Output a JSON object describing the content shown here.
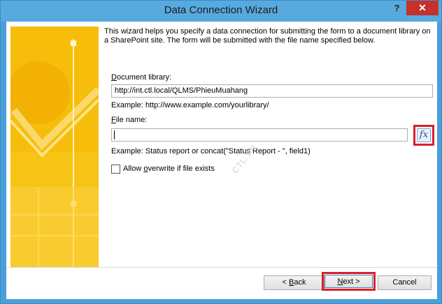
{
  "window": {
    "title": "Data Connection Wizard",
    "help_label": "?",
    "close_label": "✕"
  },
  "intro": {
    "text": "This wizard helps you specify a data connection for submitting the form to a document library on a SharePoint site. The form will be submitted with the file name specified below."
  },
  "document_library": {
    "label_accel": "D",
    "label_rest": "ocument library:",
    "value": "http://int.ctl.local/QLMS/PhieuMuahang",
    "example": "Example: http://www.example.com/yourlibrary/"
  },
  "file_name": {
    "label_accel": "F",
    "label_rest": "ile name:",
    "value": "",
    "example": "Example: Status report or concat(\"Status Report - \", field1)",
    "formula_button": "fx"
  },
  "overwrite": {
    "label_pre": "Allow ",
    "label_accel": "o",
    "label_rest": "verwrite if file exists",
    "checked": false
  },
  "watermark": "CTL.VN",
  "buttons": {
    "back_accel": "B",
    "back_pre": "< ",
    "back_rest": "ack",
    "next_accel": "N",
    "next_rest": "ext >",
    "cancel": "Cancel"
  },
  "colors": {
    "titlebar": "#58a9de",
    "close": "#c7312b",
    "highlight": "#d8202a",
    "banner": "#f7c415"
  }
}
